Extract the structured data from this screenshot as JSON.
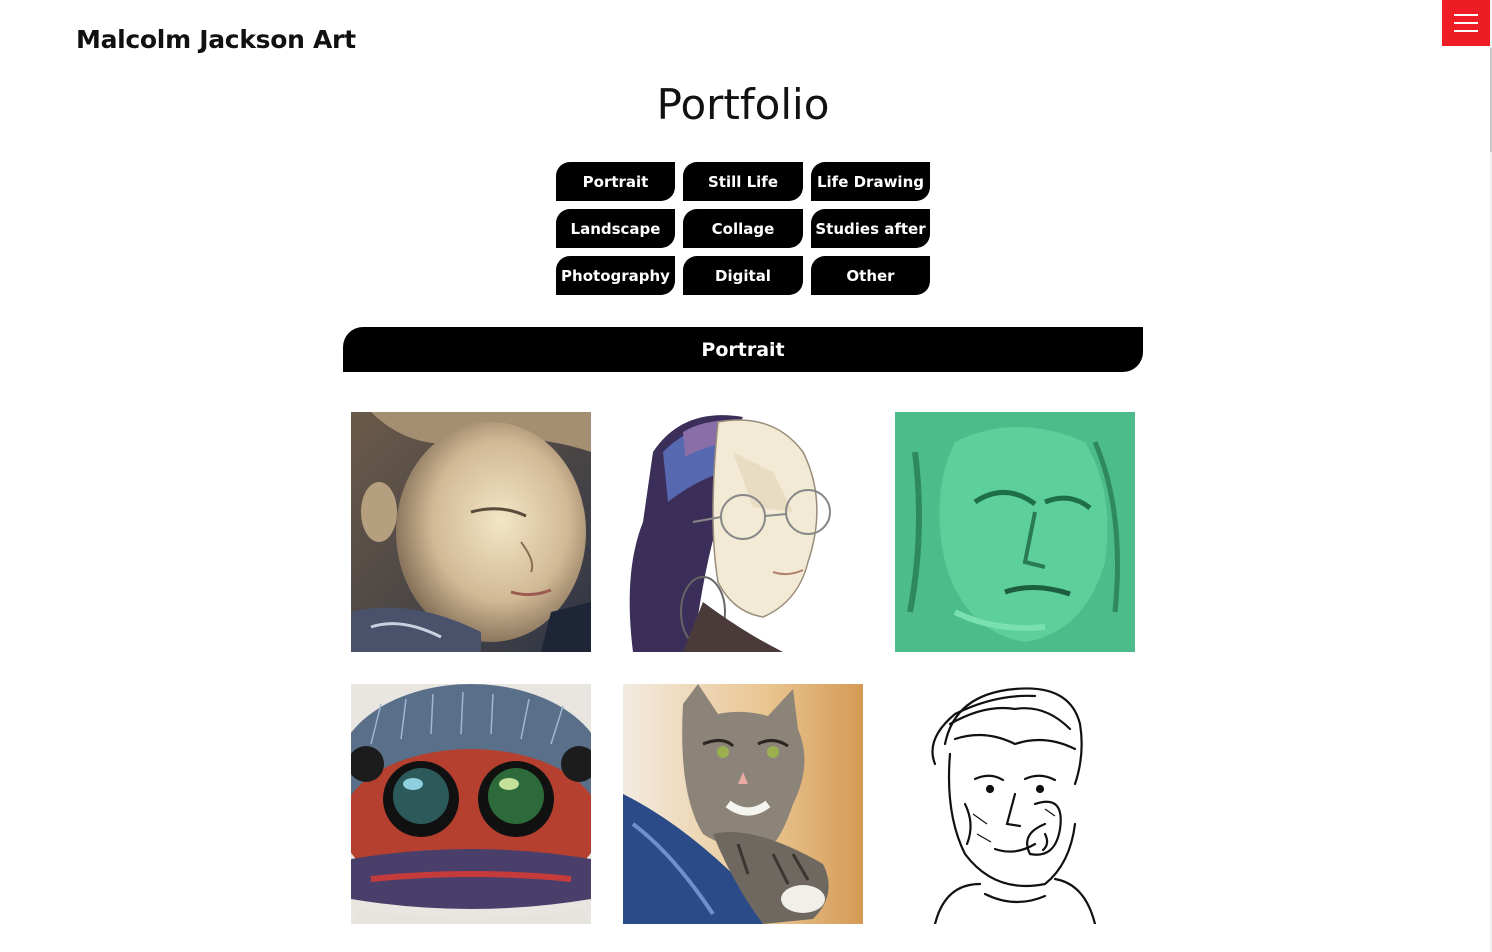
{
  "header": {
    "site_title": "Malcolm Jackson Art",
    "menu_icon": "hamburger-menu-icon",
    "accent_color": "#ee1c25"
  },
  "main": {
    "page_title": "Portfolio",
    "filters": [
      {
        "label": "Portrait"
      },
      {
        "label": "Still Life"
      },
      {
        "label": "Life Drawing"
      },
      {
        "label": "Landscape"
      },
      {
        "label": "Collage"
      },
      {
        "label": "Studies after"
      },
      {
        "label": "Photography"
      },
      {
        "label": "Digital"
      },
      {
        "label": "Other"
      }
    ],
    "section_title": "Portrait",
    "gallery": [
      {
        "subject": "child portrait painting"
      },
      {
        "subject": "watercolour woman with glasses"
      },
      {
        "subject": "green self portrait painting"
      },
      {
        "subject": "spider face painting"
      },
      {
        "subject": "tabby cat painting"
      },
      {
        "subject": "ink drawing of boy"
      }
    ]
  }
}
